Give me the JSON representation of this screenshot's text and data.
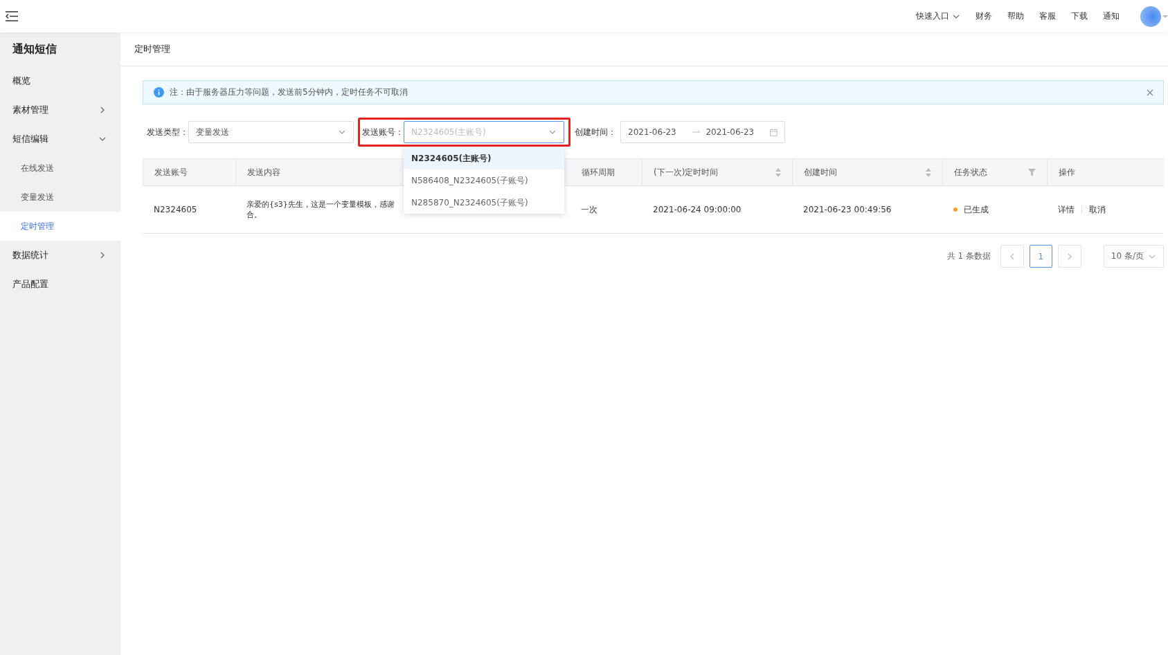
{
  "header": {
    "quick_entry": "快速入口",
    "links": [
      "财务",
      "帮助",
      "客服",
      "下载",
      "通知"
    ]
  },
  "sidebar": {
    "title": "通知短信",
    "items": [
      {
        "label": "概览",
        "kind": "plain",
        "selected": false
      },
      {
        "label": "素材管理",
        "kind": "group",
        "expanded": false,
        "selected": false
      },
      {
        "label": "短信编辑",
        "kind": "group",
        "expanded": true,
        "selected": false,
        "children": [
          {
            "label": "在线发送",
            "selected": false
          },
          {
            "label": "变量发送",
            "selected": false
          },
          {
            "label": "定时管理",
            "selected": true
          }
        ]
      },
      {
        "label": "数据统计",
        "kind": "group",
        "expanded": false,
        "selected": false
      },
      {
        "label": "产品配置",
        "kind": "plain",
        "selected": false
      }
    ]
  },
  "breadcrumb": "定时管理",
  "alert": {
    "text": "注：由于服务器压力等问题，发送前5分钟内，定时任务不可取消"
  },
  "filters": [
    {
      "kind": "select",
      "label": "发送类型：",
      "value": "变量发送",
      "open": false
    },
    {
      "kind": "select",
      "label": "发送账号：",
      "placeholder": "N2324605(主账号)",
      "highlighted": true,
      "open": true,
      "options": [
        {
          "label": "N2324605(主账号)",
          "selected": true
        },
        {
          "label": "N586408_N2324605(子账号)",
          "selected": false
        },
        {
          "label": "N285870_N2324605(子账号)",
          "selected": false
        }
      ]
    },
    {
      "kind": "date_range",
      "label": "创建时间：",
      "start": "2021-06-23",
      "end": "2021-06-23"
    }
  ],
  "table": {
    "columns": [
      {
        "title": "发送账号",
        "kind": "plain"
      },
      {
        "title": "发送内容",
        "kind": "plain"
      },
      {
        "title": "循环周期",
        "kind": "plain"
      },
      {
        "title": "(下一次)定时时间",
        "kind": "sort"
      },
      {
        "title": "创建时间",
        "kind": "sort"
      },
      {
        "title": "任务状态",
        "kind": "filter"
      },
      {
        "title": "操作",
        "kind": "plain"
      }
    ],
    "rows": [
      {
        "account": "N2324605",
        "content": [
          "亲爱的{s3}先生，这是一个变量模板，感谢",
          "合。"
        ],
        "cycle": "一次",
        "next_time": "2021-06-24 09:00:00",
        "created": "2021-06-23 00:49:56",
        "status": {
          "label": "已生成",
          "color": "#fa9e2c"
        },
        "actions": [
          "详情",
          "取消"
        ]
      }
    ]
  },
  "pagination": {
    "total": "共 1 条数据",
    "pages": [
      {
        "label": "1",
        "selected": true
      }
    ],
    "page_size": "10 条/页"
  }
}
